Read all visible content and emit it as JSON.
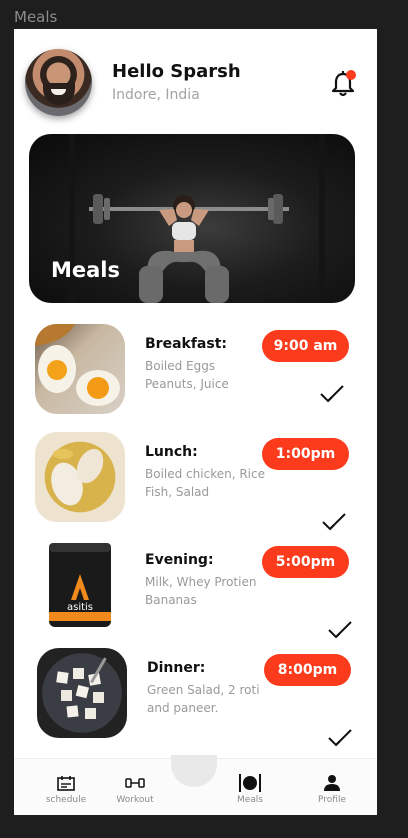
{
  "frame": {
    "label": "Meals"
  },
  "header": {
    "greeting": "Hello Sparsh",
    "location": "Indore, India",
    "avatar_icon": "user-avatar",
    "notification_icon": "bell-icon",
    "notification_dot_color": "#fb3b1c"
  },
  "hero": {
    "title": "Meals"
  },
  "meals": [
    {
      "title": "Breakfast:",
      "line1": "Boiled Eggs",
      "line2": "Peanuts, Juice",
      "time": "9:00 am",
      "status_icon": "check-icon"
    },
    {
      "title": "Lunch:",
      "line1": "Boiled chicken, Rice",
      "line2": "Fish, Salad",
      "time": "1:00pm",
      "status_icon": "check-icon"
    },
    {
      "title": "Evening:",
      "line1": "Milk, Whey Protien",
      "line2": "Bananas",
      "time": "5:00pm",
      "status_icon": "check-icon",
      "product_label": "asitis"
    },
    {
      "title": "Dinner:",
      "line1": "Green Salad, 2 roti",
      "line2": "and paneer.",
      "time": "8:00pm",
      "status_icon": "check-icon"
    }
  ],
  "nav": {
    "items": [
      {
        "label": "schedule",
        "icon": "calendar-icon"
      },
      {
        "label": "Workout",
        "icon": "dumbbell-icon"
      },
      {
        "label": "Meals",
        "icon": "cutlery-icon"
      },
      {
        "label": "Profile",
        "icon": "person-icon"
      }
    ]
  },
  "colors": {
    "accent": "#fb3b1c",
    "background": "#1e1e1e",
    "card": "#ffffff"
  }
}
